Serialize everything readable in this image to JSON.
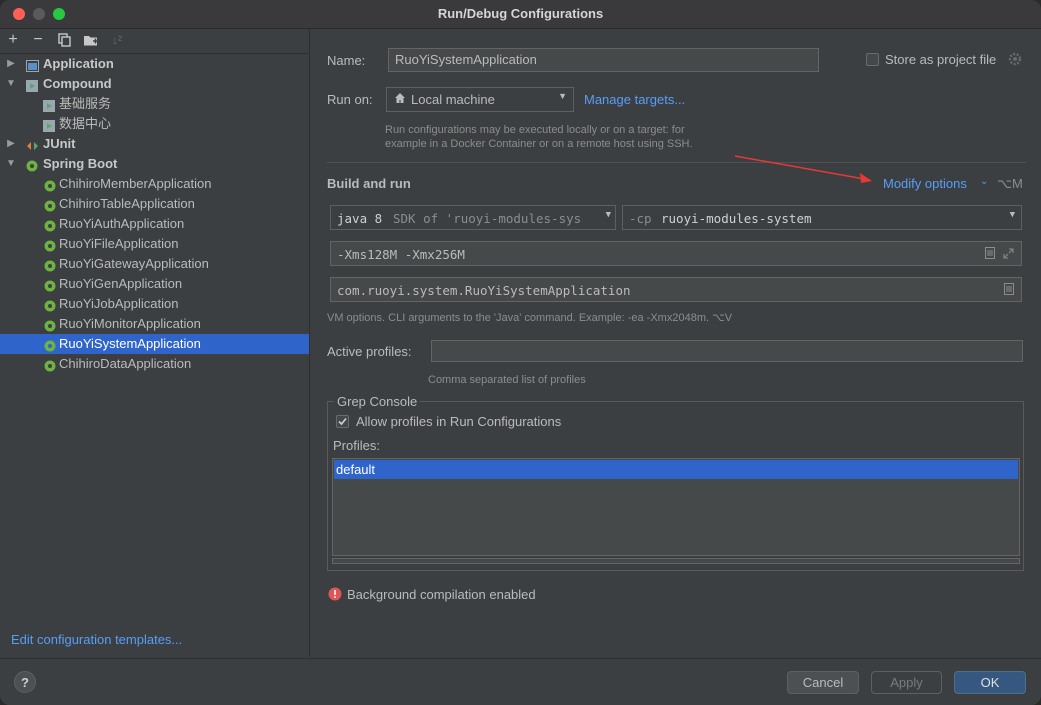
{
  "window": {
    "title": "Run/Debug Configurations"
  },
  "toolbar": {
    "icons": [
      "add-icon",
      "remove-icon",
      "copy-icon",
      "folder-icon",
      "sort-icon"
    ],
    "add": "+",
    "remove": "−",
    "sort": "↓²"
  },
  "tree": {
    "application": "Application",
    "compound": "Compound",
    "compound_items": [
      "基础服务",
      "数据中心"
    ],
    "junit": "JUnit",
    "spring_boot": "Spring Boot",
    "spring_items": [
      "ChihiroMemberApplication",
      "ChihiroTableApplication",
      "RuoYiAuthApplication",
      "RuoYiFileApplication",
      "RuoYiGatewayApplication",
      "RuoYiGenApplication",
      "RuoYiJobApplication",
      "RuoYiMonitorApplication",
      "RuoYiSystemApplication",
      "ChihiroDataApplication"
    ],
    "selected": "RuoYiSystemApplication"
  },
  "edit_templates": "Edit configuration templates...",
  "form": {
    "name_label": "Name:",
    "name_value": "RuoYiSystemApplication",
    "store_label": "Store as project file",
    "run_on_label": "Run on:",
    "run_on_value": "Local machine",
    "manage_targets": "Manage targets...",
    "run_on_hint_1": "Run configurations may be executed locally or on a target: for",
    "run_on_hint_2": "example in a Docker Container or on a remote host using SSH.",
    "build_and_run": "Build and run",
    "modify_options": "Modify options",
    "modify_shortcut": "⌥M",
    "jdk_main": "java 8",
    "jdk_hint": "SDK of 'ruoyi-modules-sys",
    "cp_flag": "-cp",
    "cp_value": "ruoyi-modules-system",
    "vm_options": "-Xms128M -Xmx256M",
    "main_class": "com.ruoyi.system.RuoYiSystemApplication",
    "vm_hint": "VM options. CLI arguments to the 'Java' command. Example: -ea -Xmx2048m. ⌥V",
    "active_profiles_label": "Active profiles:",
    "active_profiles_value": "",
    "active_profiles_hint": "Comma separated list of profiles",
    "grep_console": "Grep Console",
    "allow_profiles": "Allow profiles in Run Configurations",
    "allow_profiles_checked": true,
    "profiles_label": "Profiles:",
    "profiles": [
      "default"
    ],
    "warning": "Background compilation enabled"
  },
  "buttons": {
    "help": "?",
    "cancel": "Cancel",
    "apply": "Apply",
    "ok": "OK"
  },
  "colors": {
    "selection": "#2f65ca",
    "link": "#589df6",
    "ok": "#365880",
    "error": "#e05555",
    "arrow": "#e53935"
  }
}
